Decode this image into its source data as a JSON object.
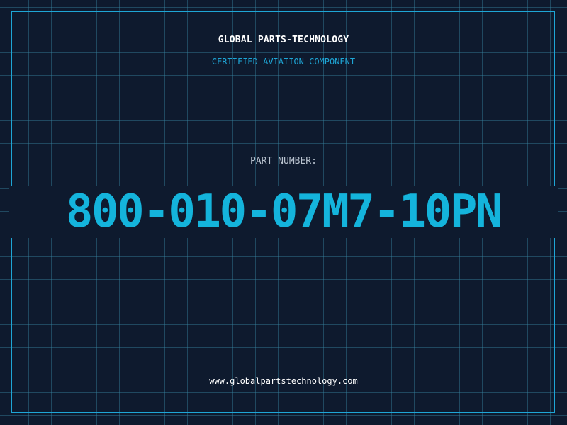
{
  "header": {
    "company": "GLOBAL PARTS-TECHNOLOGY",
    "subtitle": "CERTIFIED AVIATION COMPONENT"
  },
  "part": {
    "label": "PART NUMBER:",
    "number": "800-010-07M7-10PN"
  },
  "footer": {
    "website": "www.globalpartstechnology.com"
  },
  "colors": {
    "background": "#0e1a2e",
    "accent": "#1ea6d6",
    "part_number": "#14b4dc",
    "label": "#b8c2ce",
    "text": "#ffffff"
  }
}
